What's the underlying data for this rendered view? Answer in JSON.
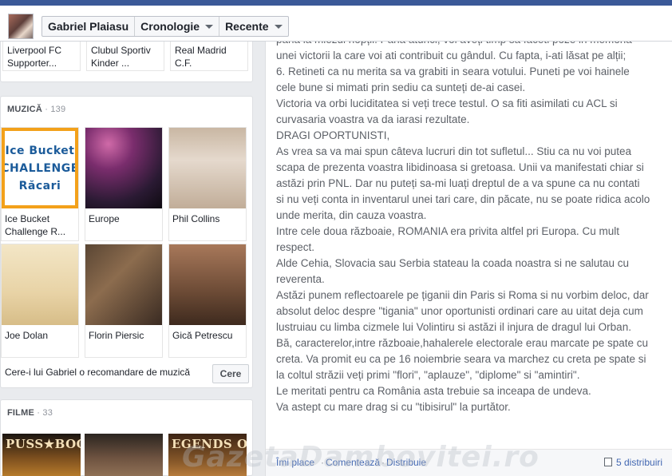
{
  "topbar": {
    "profile_name": "Gabriel Plaiasu",
    "timeline_label": "Cronologie",
    "recent_label": "Recente",
    "accent_color": "#3b5998"
  },
  "teams": [
    {
      "name_line1": "Liverpool FC",
      "name_line2": "Supporter..."
    },
    {
      "name_line1": "Clubul Sportiv",
      "name_line2": "Kinder ..."
    },
    {
      "name_line1": "Real Madrid",
      "name_line2": "C.F."
    }
  ],
  "music": {
    "title": "MUZICĂ",
    "count": "· 139",
    "items": [
      {
        "label": "Ice Bucket Challenge R...",
        "image_text": [
          "Ice Bucket",
          "CHALLENGE",
          "Răcari"
        ]
      },
      {
        "label": "Europe"
      },
      {
        "label": "Phil Collins"
      },
      {
        "label": "Joe Dolan"
      },
      {
        "label": "Florin Piersic"
      },
      {
        "label": "Gică Petrescu"
      }
    ],
    "recommend_text": "Cere-i lui Gabriel o recomandare de muzică",
    "recommend_button": "Cere"
  },
  "films": {
    "title": "FILME",
    "count": "· 33",
    "captions": [
      "PUSS★BOOTS",
      "",
      "EGENDS OF THE FA"
    ]
  },
  "post": {
    "lines": [
      "pana la miezul nopții. Pana atunci, voi aveți timp sa faceti poze in memoria",
      "unei victorii la care voi ati contribuit cu gândul. Cu fapta, i-ati lăsat pe alții;",
      "6. Retineti ca nu merita sa va grabiti in seara votului. Puneti pe voi hainele",
      "cele bune si mimati prin sediu ca sunteți de-ai casei.",
      "Victoria va orbi luciditatea si veți trece testul. O sa fiti asimilati cu ACL si",
      "curvasaria voastra va da iarasi rezultate.",
      "DRAGI OPORTUNISTI,",
      "As vrea sa va mai spun câteva lucruri din tot sufletul... Stiu ca nu voi putea",
      "scapa de prezenta voastra libidinoasa si gretoasa. Unii va manifestati chiar si",
      "astăzi prin PNL. Dar nu puteți sa-mi luați dreptul de a va spune ca nu contati",
      "si nu veți conta in inventarul unei tari care, din păcate, nu se poate ridica acolo",
      "unde merita, din cauza voastra.",
      "Intre cele doua războaie, ROMANIA era privita altfel pri Europa. Cu mult",
      "respect.",
      "Alde Cehia, Slovacia sau Serbia stateau la coada noastra si ne salutau cu",
      "reverenta.",
      "Astăzi punem reflectoarele pe țiganii din Paris si Roma si nu vorbim deloc, dar",
      "absolut deloc despre \"tigania\" unor oportunisti ordinari care au uitat deja cum",
      "lustruiau cu limba cizmele lui Volintiru si astăzi il injura de dragul lui Orban.",
      "Bă, caracterelor,intre războaie,hahalerele electorale erau marcate pe spate cu",
      "creta. Va promit eu ca pe 16 noiembrie seara va marchez cu creta pe spate si",
      "la coltul străzii veți primi \"flori\", \"aplauze\", \"diplome\" si \"amintiri\".",
      "Le meritati pentru ca România asta trebuie sa inceapa de undeva.",
      "Va astept cu mare drag si cu \"tibisirul\" la purtător."
    ],
    "like_label": "Îmi place",
    "comment_label": "Comentează",
    "share_label": "Distribuie",
    "shares_count": "5 distribuiri"
  },
  "watermark": "GazetaDambovitei.ro"
}
